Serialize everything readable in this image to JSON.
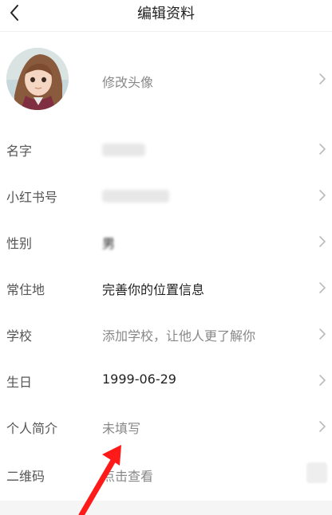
{
  "header": {
    "title": "编辑资料"
  },
  "avatar_row": {
    "label": "修改头像"
  },
  "rows": [
    {
      "label": "名字",
      "value": ""
    },
    {
      "label": "小红书号",
      "value": ""
    },
    {
      "label": "性别",
      "value": "男"
    },
    {
      "label": "常住地",
      "value": "完善你的位置信息"
    },
    {
      "label": "学校",
      "value": "添加学校，让他人更了解你"
    },
    {
      "label": "生日",
      "value": "1999-06-29"
    },
    {
      "label": "个人简介",
      "value": "未填写"
    },
    {
      "label": "二维码",
      "value": "点击查看"
    }
  ],
  "annotation": {
    "arrow_color": "#ff1a1a"
  }
}
